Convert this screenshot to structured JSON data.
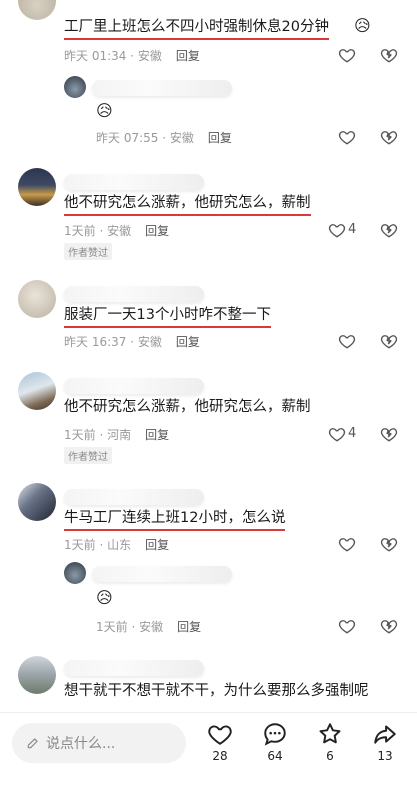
{
  "comments": [
    {
      "text": "工厂里上班怎么不四小时强制休息20分钟",
      "emoji": "😥",
      "time": "昨天 01:34 · 安徽",
      "reply_label": "回复",
      "replies": [
        {
          "emoji": "😥",
          "time": "昨天 07:55 · 安徽",
          "reply_label": "回复"
        }
      ]
    },
    {
      "text": "他不研究怎么涨薪，他研究怎么，薪制",
      "time": "1天前 · 安徽",
      "reply_label": "回复",
      "likes": "4",
      "badge": "作者赞过"
    },
    {
      "text": "服装厂一天13个小时咋不整一下",
      "time": "昨天 16:37 · 安徽",
      "reply_label": "回复"
    },
    {
      "text": "他不研究怎么涨薪，他研究怎么，薪制",
      "time": "1天前 · 河南",
      "reply_label": "回复",
      "likes": "4",
      "badge": "作者赞过"
    },
    {
      "text": "牛马工厂连续上班12小时，怎么说",
      "time": "1天前 · 山东",
      "reply_label": "回复",
      "replies": [
        {
          "emoji": "😥",
          "time": "1天前 · 安徽",
          "reply_label": "回复"
        }
      ]
    },
    {
      "text": "想干就干不想干就不干，为什么要那么多强制呢"
    }
  ],
  "bottom_bar": {
    "input_placeholder": "说点什么...",
    "likes": "28",
    "comments": "64",
    "favorites": "6",
    "shares": "13"
  },
  "colors": {
    "underline": "#d83a3a",
    "meta_text": "#9a9a9a",
    "icon_stroke": "#222222"
  },
  "icons": [
    "heart-icon",
    "broken-heart-icon",
    "pen-icon",
    "comment-bubble-icon",
    "star-icon",
    "share-arrow-icon",
    "chevron-down-icon"
  ]
}
